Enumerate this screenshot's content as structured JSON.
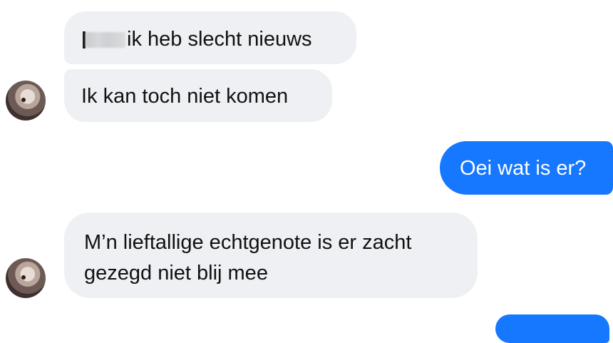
{
  "messages": [
    {
      "id": "m1",
      "direction": "incoming",
      "text": "ik heb slecht nieuws",
      "redacted_prefix": true
    },
    {
      "id": "m2",
      "direction": "incoming",
      "text": "Ik kan toch niet komen"
    },
    {
      "id": "m3",
      "direction": "outgoing",
      "text": "Oei wat is er?"
    },
    {
      "id": "m4",
      "direction": "incoming",
      "text": "M’n lieftallige echtgenote is er zacht gezegd niet blij mee"
    },
    {
      "id": "m5",
      "direction": "outgoing",
      "text": ""
    }
  ],
  "colors": {
    "incoming_bubble": "#eff0f3",
    "outgoing_bubble": "#1677ff",
    "incoming_text": "#111111",
    "outgoing_text": "#ffffff"
  },
  "icons": {
    "avatar": "contact-avatar-blurred"
  }
}
